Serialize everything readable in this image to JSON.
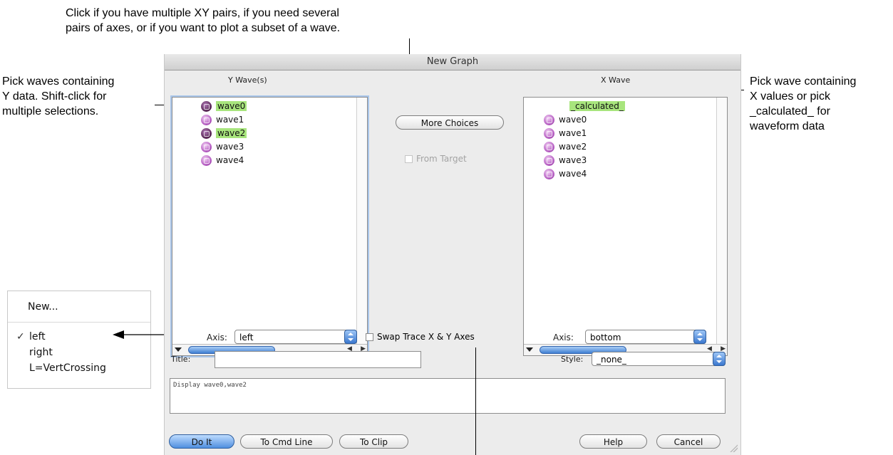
{
  "annotations": {
    "top_line1": "Click if you have multiple XY pairs, if you need several",
    "top_line2": "pairs of axes, or if you want to plot a subset of a wave.",
    "left_line1": "Pick waves containing",
    "left_line2": "Y data. Shift-click for",
    "left_line3": "multiple selections.",
    "right_line1": "Pick wave containing",
    "right_line2": "X values or pick",
    "right_line3": "_calculated_ for",
    "right_line4": "waveform data"
  },
  "dialog": {
    "title": "New Graph",
    "y_header": "Y Wave(s)",
    "x_header": "X Wave",
    "y_waves": [
      {
        "name": "wave0",
        "selected": true
      },
      {
        "name": "wave1",
        "selected": false
      },
      {
        "name": "wave2",
        "selected": true
      },
      {
        "name": "wave3",
        "selected": false
      },
      {
        "name": "wave4",
        "selected": false
      }
    ],
    "x_waves": {
      "calculated": "_calculated_",
      "items": [
        "wave0",
        "wave1",
        "wave2",
        "wave3",
        "wave4"
      ]
    },
    "more_choices_label": "More Choices",
    "from_target_label": "From Target",
    "y_axis_label": "Axis:",
    "y_axis_value": "left",
    "swap_label": "Swap Trace X & Y Axes",
    "x_axis_label": "Axis:",
    "x_axis_value": "bottom",
    "title_label": "Title:",
    "title_value": "",
    "style_label": "Style:",
    "style_value": "_none_",
    "command": "Display wave0,wave2",
    "buttons": {
      "do_it": "Do It",
      "to_cmd_line": "To Cmd Line",
      "to_clip": "To Clip",
      "help": "Help",
      "cancel": "Cancel"
    }
  },
  "axis_menu": {
    "items": [
      "New...",
      "left",
      "right",
      "L=VertCrossing"
    ],
    "checked": "left",
    "check_mark": "✓"
  },
  "colors": {
    "selection_highlight": "#a8e57d",
    "default_button": "#4f8fdf",
    "focus_ring": "#a9c6ea"
  }
}
